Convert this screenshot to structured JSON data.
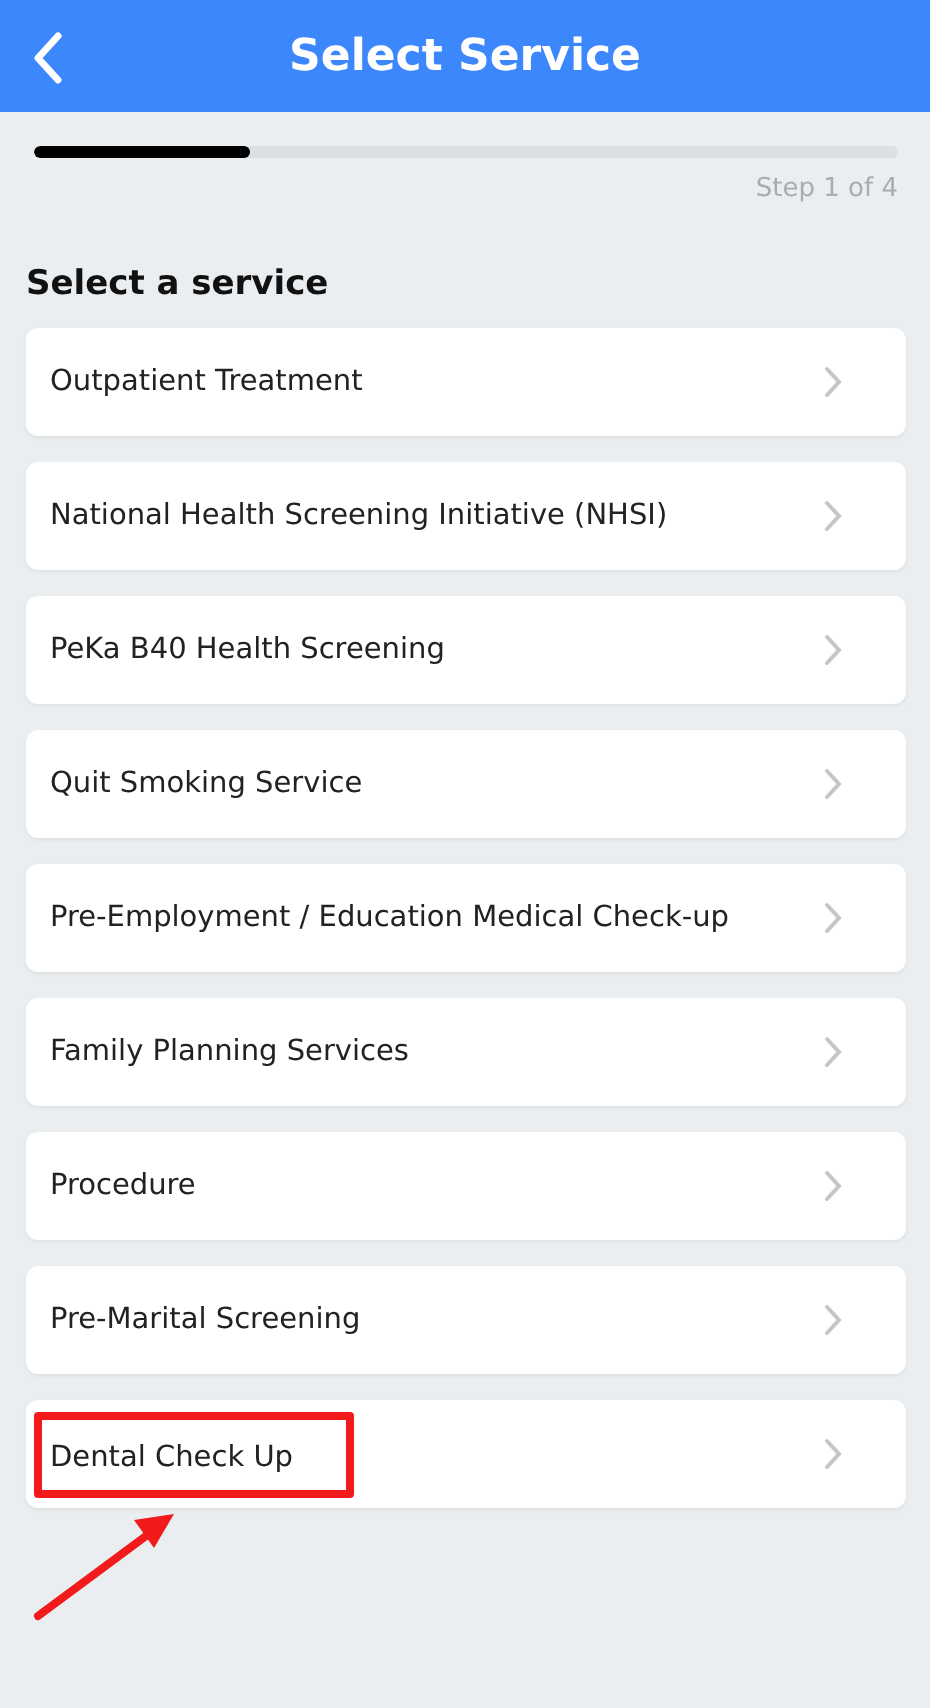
{
  "header": {
    "title": "Select Service"
  },
  "progress": {
    "level": 0.25,
    "step_text": "Step 1 of 4"
  },
  "section_title": "Select a service",
  "services": [
    {
      "label": "Outpatient Treatment",
      "highlighted": false
    },
    {
      "label": "National Health Screening Initiative (NHSI)",
      "highlighted": false
    },
    {
      "label": "PeKa B40 Health Screening",
      "highlighted": false
    },
    {
      "label": "Quit Smoking Service",
      "highlighted": false
    },
    {
      "label": "Pre-Employment / Education Medical Check-up",
      "highlighted": false
    },
    {
      "label": "Family Planning Services",
      "highlighted": false
    },
    {
      "label": "Procedure",
      "highlighted": false
    },
    {
      "label": "Pre-Marital Screening",
      "highlighted": false
    },
    {
      "label": "Dental Check Up",
      "highlighted": true
    }
  ]
}
